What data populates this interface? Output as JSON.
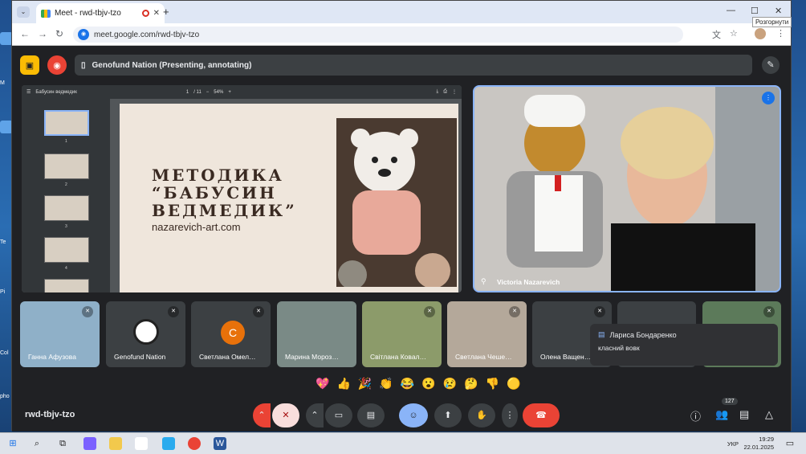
{
  "browser": {
    "tab_title": "Meet - rwd-tbjv-tzo",
    "url": "meet.google.com/rwd-tbjv-tzo",
    "tooltip": "Розгорнути"
  },
  "presentation": {
    "label": "Genofund Nation (Presenting, annotating)"
  },
  "pdf": {
    "doc_title": "Бабусин ведмедик",
    "page": "1",
    "page_total": "/ 11",
    "zoom": "54%",
    "thumb_numbers": [
      "1",
      "2",
      "3",
      "4"
    ],
    "slide_title": "МЕТОДИКА\n“БАБУСИН\nВЕДМЕДИК”",
    "slide_url": "nazarevich-art.com"
  },
  "speaker": {
    "name": "Victoria Nazarevich"
  },
  "tiles": [
    {
      "name": "Ганна Афузова"
    },
    {
      "name": "Genofund Nation"
    },
    {
      "name": "Светлана Омел…",
      "initial": "С"
    },
    {
      "name": "Марина Мороз…"
    },
    {
      "name": "Світлана Ковал…"
    },
    {
      "name": "Светлана Чеше…"
    },
    {
      "name": "Олена Ващен…"
    }
  ],
  "chat": {
    "author": "Лариса Бондаренко",
    "message": "класний вовк"
  },
  "reactions": [
    "💖",
    "👍",
    "🎉",
    "👏",
    "😂",
    "😮",
    "😢",
    "🤔",
    "👎",
    "🟡"
  ],
  "meeting_code": "rwd-tbjv-tzo",
  "participants_count": "127",
  "taskbar": {
    "lang": "УКР",
    "time": "19:29",
    "date": "22.01.2025"
  },
  "desktop": {
    "labels": [
      "M",
      "Te",
      "Pi",
      "Col",
      "pho"
    ]
  },
  "colors": {
    "meet_bg": "#202124",
    "active_blue": "#8ab4f8",
    "end_red": "#ea4335",
    "present_yellow": "#fbbc04"
  }
}
